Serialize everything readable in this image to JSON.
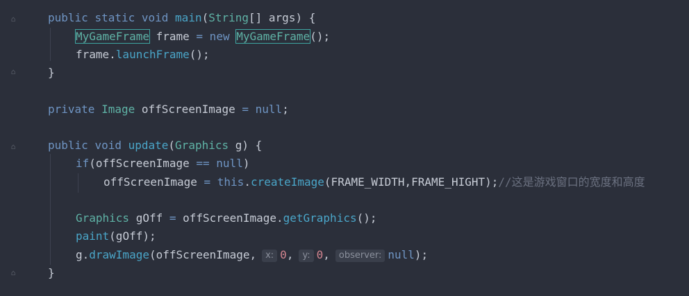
{
  "code": {
    "l1": {
      "k1": "public",
      "k2": "static",
      "k3": "void",
      "fn": "main",
      "p1": "(",
      "type": "String",
      "rest": "[] args) {"
    },
    "l2": {
      "t1": "MyGameFrame",
      "mid": " frame ",
      "eq": "=",
      "kw": " new ",
      "t2": "MyGameFrame",
      "end": "();"
    },
    "l3": {
      "obj": "frame.",
      "fn": "launchFrame",
      "end": "();"
    },
    "l4": {
      "brace": "}"
    },
    "l5": {
      "kw": "private",
      "type": "Image",
      "id": " offScreenImage ",
      "eq": "=",
      "nul": " null",
      "end": ";"
    },
    "l6": {
      "k1": "public",
      "k2": "void",
      "fn": "update",
      "p": "(",
      "type": "Graphics",
      "rest": " g) {"
    },
    "l7": {
      "kw": "if",
      "p": "(offScreenImage ",
      "op": "==",
      "nul": " null",
      "end": ")"
    },
    "l8": {
      "id": "offScreenImage ",
      "eq": "=",
      "kw": " this",
      "dot": ".",
      "fn": "createImage",
      "args": "(FRAME_WIDTH,FRAME_HIGHT);",
      "comment": "//这是游戏窗口的宽度和高度"
    },
    "l9": {
      "type": "Graphics",
      "id": " gOff ",
      "eq": "=",
      "obj": " offScreenImage.",
      "fn": "getGraphics",
      "end": "();"
    },
    "l10": {
      "fn": "paint",
      "end": "(gOff);"
    },
    "l11": {
      "obj": "g.",
      "fn": "drawImage",
      "args": "(offScreenImage,",
      "hint_x": "x:",
      "v1": "0",
      "comma": ",",
      "hint_y": "y:",
      "v2": "0",
      "hint_o": "observer:",
      "nul": "null",
      "end": ");"
    },
    "l12": {
      "brace": "}"
    }
  }
}
